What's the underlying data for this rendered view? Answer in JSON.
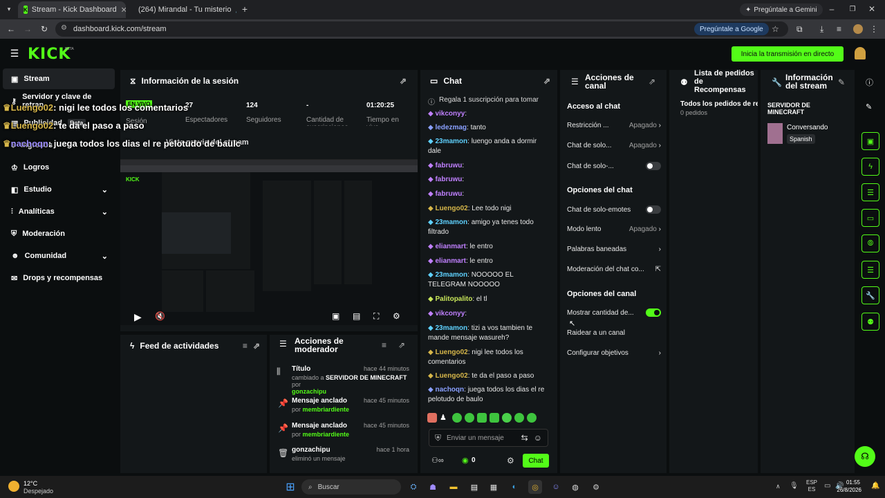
{
  "browser": {
    "tabs": [
      {
        "title": "Stream - Kick Dashboard",
        "active": true
      },
      {
        "title": "(264) Mirandal - Tu misterio",
        "active": false
      }
    ],
    "gemini_label": "Pregúntale a Gemini",
    "url": "dashboard.kick.com/stream",
    "google_pill": "Pregúntale a Google"
  },
  "app": {
    "logo": "KICK",
    "beta": "BETA",
    "start_button": "Inicia la transmisión en directo",
    "accent": "#53fc18"
  },
  "sidebar": {
    "items": [
      {
        "label": "Stream",
        "icon": "video-icon",
        "active": true
      },
      {
        "label": "Servidor y clave de retran",
        "icon": "key-icon"
      },
      {
        "label": "Publicidad",
        "icon": "ad-icon",
        "badge": "Beta"
      },
      {
        "label": "Ingresos",
        "icon": "dollar-icon"
      },
      {
        "label": "Logros",
        "icon": "trophy-icon"
      },
      {
        "label": "Estudio",
        "icon": "studio-icon"
      },
      {
        "label": "Analíticas",
        "icon": "chart-icon"
      },
      {
        "label": "Moderación",
        "icon": "shield-icon"
      },
      {
        "label": "Comunidad",
        "icon": "people-icon"
      },
      {
        "label": "Drops y recompensas",
        "icon": "gift-icon"
      }
    ]
  },
  "overlay_chat": [
    {
      "user": "Luengo02",
      "text": ": nigi lee todos los comentarios"
    },
    {
      "user": "Luengo02",
      "text": ": te da el paso a paso"
    },
    {
      "user": "nachoqn",
      "text": ": juega todos los dias el re pelotudo de baulc"
    }
  ],
  "session": {
    "title": "Información de la sesión",
    "stats": [
      {
        "value": "27",
        "label": "Espectadores",
        "badge": "EN VIVO",
        "badge_sub": "Sesión"
      },
      {
        "value": "124",
        "label": "Seguidores"
      },
      {
        "value": "-",
        "label": "Cantidad de suscripciones"
      },
      {
        "value": "01:20:25",
        "label": "Tiempo en vivo"
      }
    ],
    "preview_caption": "Vista previa del stream"
  },
  "activity_feed": {
    "title": "Feed de actividades"
  },
  "mod_actions": {
    "title": "Acciones de moderador",
    "items": [
      {
        "title": "Título",
        "time": "hace 44 minutos",
        "line1_prefix": "cambiado a",
        "line1_value": "SERVIDOR DE MINECRAFT",
        "line1_suffix": "por",
        "user": "gonzachipu",
        "icon": "sliders-icon"
      },
      {
        "title": "Mensaje anclado",
        "time": "hace 45 minutos",
        "line1_prefix": "por",
        "user": "membriardiente",
        "icon": "pin-icon"
      },
      {
        "title": "Mensaje anclado",
        "time": "hace 45 minutos",
        "line1_prefix": "por",
        "user": "membriardiente",
        "icon": "pin-icon"
      },
      {
        "title": "gonzachipu",
        "time": "hace 1 hora",
        "line1_prefix": "eliminó un mensaje",
        "icon": "trash-icon"
      }
    ]
  },
  "chat": {
    "title": "Chat",
    "pinned": "Regala 1 suscripción para tomar",
    "messages": [
      {
        "user": "vikconyy",
        "text": ":",
        "color": "#c080ff"
      },
      {
        "user": "ledezmag",
        "text": ": tanto",
        "color": "#8aa0ff"
      },
      {
        "user": "23mamon",
        "text": ": luengo anda a dormir dale",
        "color": "#5fd1ff"
      },
      {
        "user": "fabruwu",
        "text": ":",
        "color": "#c080ff"
      },
      {
        "user": "fabruwu",
        "text": ":",
        "color": "#c080ff"
      },
      {
        "user": "fabruwu",
        "text": ":",
        "color": "#c080ff"
      },
      {
        "user": "Luengo02",
        "text": ": Lee todo nigi",
        "color": "#d7b74a"
      },
      {
        "user": "23mamon",
        "text": ": amigo ya tenes todo filtrado",
        "color": "#5fd1ff"
      },
      {
        "user": "elianmart",
        "text": ": le entro",
        "color": "#c080ff"
      },
      {
        "user": "elianmart",
        "text": ": le entro",
        "color": "#c080ff"
      },
      {
        "user": "23mamon",
        "text": ": NOOOOO EL TELEGRAM NOOOOO",
        "color": "#5fd1ff"
      },
      {
        "user": "Palitopalito",
        "text": ": el tl",
        "color": "#c8e65a"
      },
      {
        "user": "vikconyy",
        "text": ":",
        "color": "#c080ff"
      },
      {
        "user": "23mamon",
        "text": ": tizi a vos tambien te mande mensaje wasureh?",
        "color": "#5fd1ff"
      },
      {
        "user": "Luengo02",
        "text": ": nigi lee todos los comentarios",
        "color": "#d7b74a"
      },
      {
        "user": "Luengo02",
        "text": ": te da el paso a paso",
        "color": "#d7b74a"
      },
      {
        "user": "nachoqn",
        "text": ": juega todos los dias el re pelotudo de baulo",
        "color": "#8aa0ff"
      }
    ],
    "input_placeholder": "Enviar un mensaje",
    "points": "0",
    "send_label": "Chat"
  },
  "channel_actions": {
    "title": "Acciones de canal",
    "sections": [
      {
        "heading": "Acceso al chat",
        "rows": [
          {
            "label": "Restricción ...",
            "value": "Apagado",
            "control": "chevron"
          },
          {
            "label": "Chat de solo...",
            "value": "Apagado",
            "control": "chevron"
          },
          {
            "label": "Chat de solo-...",
            "value": "",
            "control": "toggle-off"
          }
        ]
      },
      {
        "heading": "Opciones del chat",
        "rows": [
          {
            "label": "Chat de solo-emotes",
            "value": "",
            "control": "toggle-off"
          },
          {
            "label": "Modo lento",
            "value": "Apagado",
            "control": "chevron"
          },
          {
            "label": "Palabras baneadas",
            "value": "",
            "control": "chevron"
          },
          {
            "label": "Moderación del chat co...",
            "value": "",
            "control": "external"
          }
        ]
      },
      {
        "heading": "Opciones del canal",
        "rows": [
          {
            "label": "Mostrar cantidad de...",
            "value": "",
            "control": "toggle-on"
          },
          {
            "label": "Raidear a un canal",
            "value": "",
            "control": "none"
          },
          {
            "label": "Configurar objetivos",
            "value": "",
            "control": "chevron"
          }
        ]
      }
    ]
  },
  "rewards": {
    "title": "Lista de pedidos de Recompensas",
    "all_label": "Todos los pedidos de rec",
    "count": "0 pedidos"
  },
  "stream_info": {
    "title": "Información del stream",
    "stream_title": "SERVIDOR DE MINECRAFT",
    "category": "Conversando",
    "language": "Spanish"
  },
  "taskbar": {
    "weather_temp": "12°C",
    "weather_desc": "Despejado",
    "search_placeholder": "Buscar",
    "lang_top": "ESP",
    "lang_bottom": "ES",
    "time": "01:55",
    "date": "26/8/2026"
  }
}
